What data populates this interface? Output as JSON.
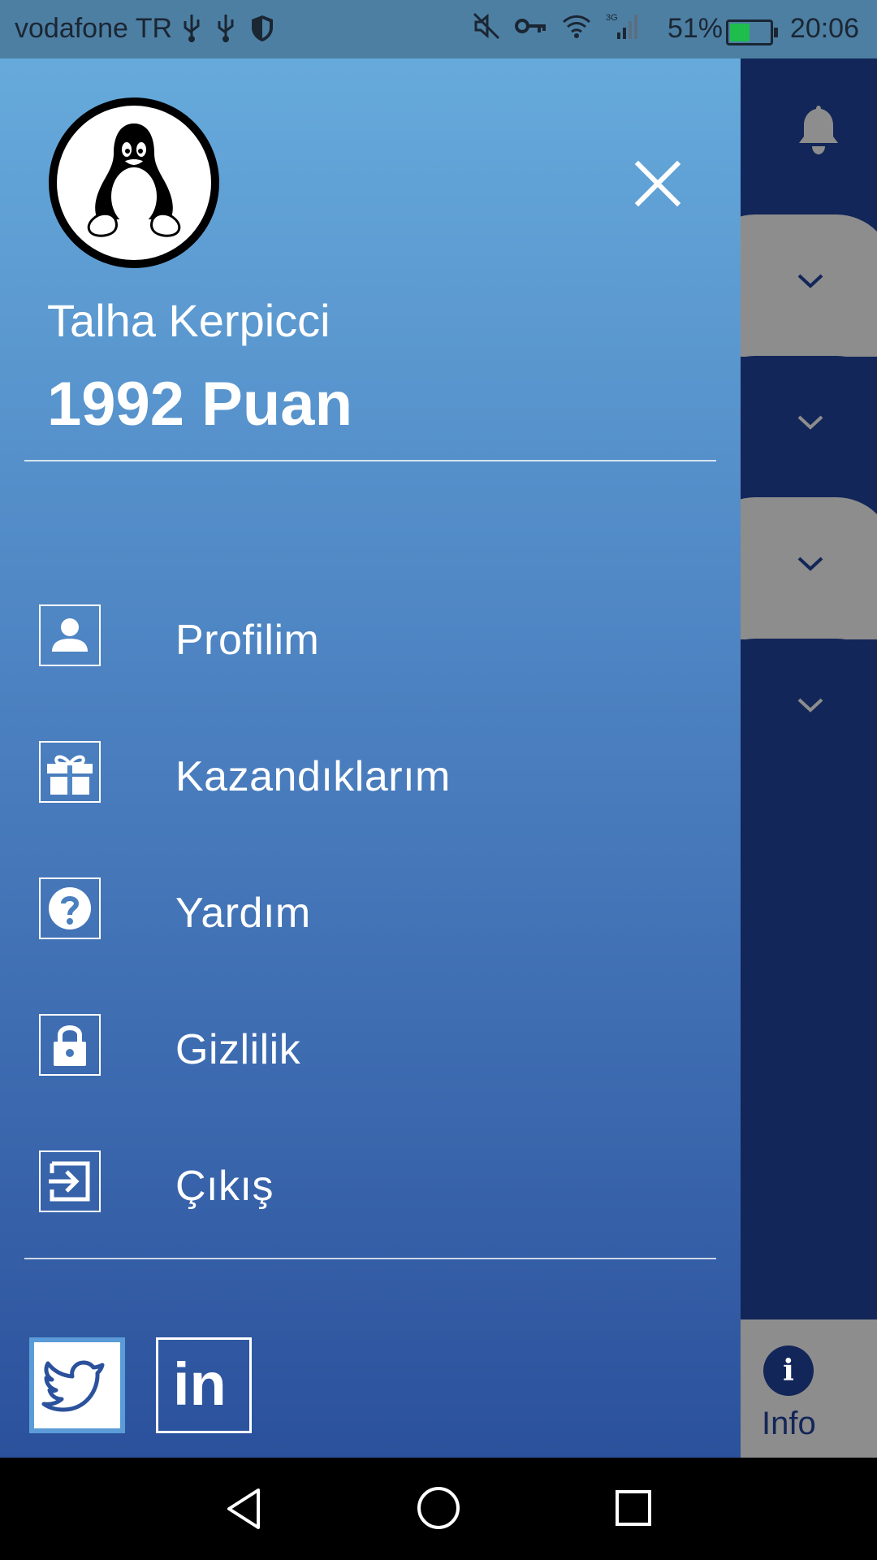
{
  "status_bar": {
    "carrier": "vodafone TR",
    "battery": "51%",
    "time": "20:06",
    "network": "3G",
    "icons": [
      "usb-icon",
      "usb-icon",
      "shield-icon",
      "mute-icon",
      "key-icon",
      "wifi-icon",
      "signal-icon",
      "battery-icon"
    ]
  },
  "drawer": {
    "user_name": "Talha Kerpicci",
    "points": "1992 Puan",
    "avatar_icon": "penguin-icon",
    "menu": [
      {
        "label": "Profilim",
        "icon": "person-icon"
      },
      {
        "label": "Kazandıklarım",
        "icon": "gift-icon"
      },
      {
        "label": "Yardım",
        "icon": "help-icon"
      },
      {
        "label": "Gizlilik",
        "icon": "lock-icon"
      },
      {
        "label": "Çıkış",
        "icon": "logout-icon"
      }
    ],
    "social": [
      "twitter-icon",
      "linkedin-icon"
    ],
    "linkedin_text": "in"
  },
  "background": {
    "info_label": "Info",
    "info_glyph": "i"
  },
  "colors": {
    "drawer_top": "#66aadb",
    "drawer_bottom": "#2b519c",
    "app_navy": "#132659",
    "card_gray": "#8d8d8d"
  }
}
